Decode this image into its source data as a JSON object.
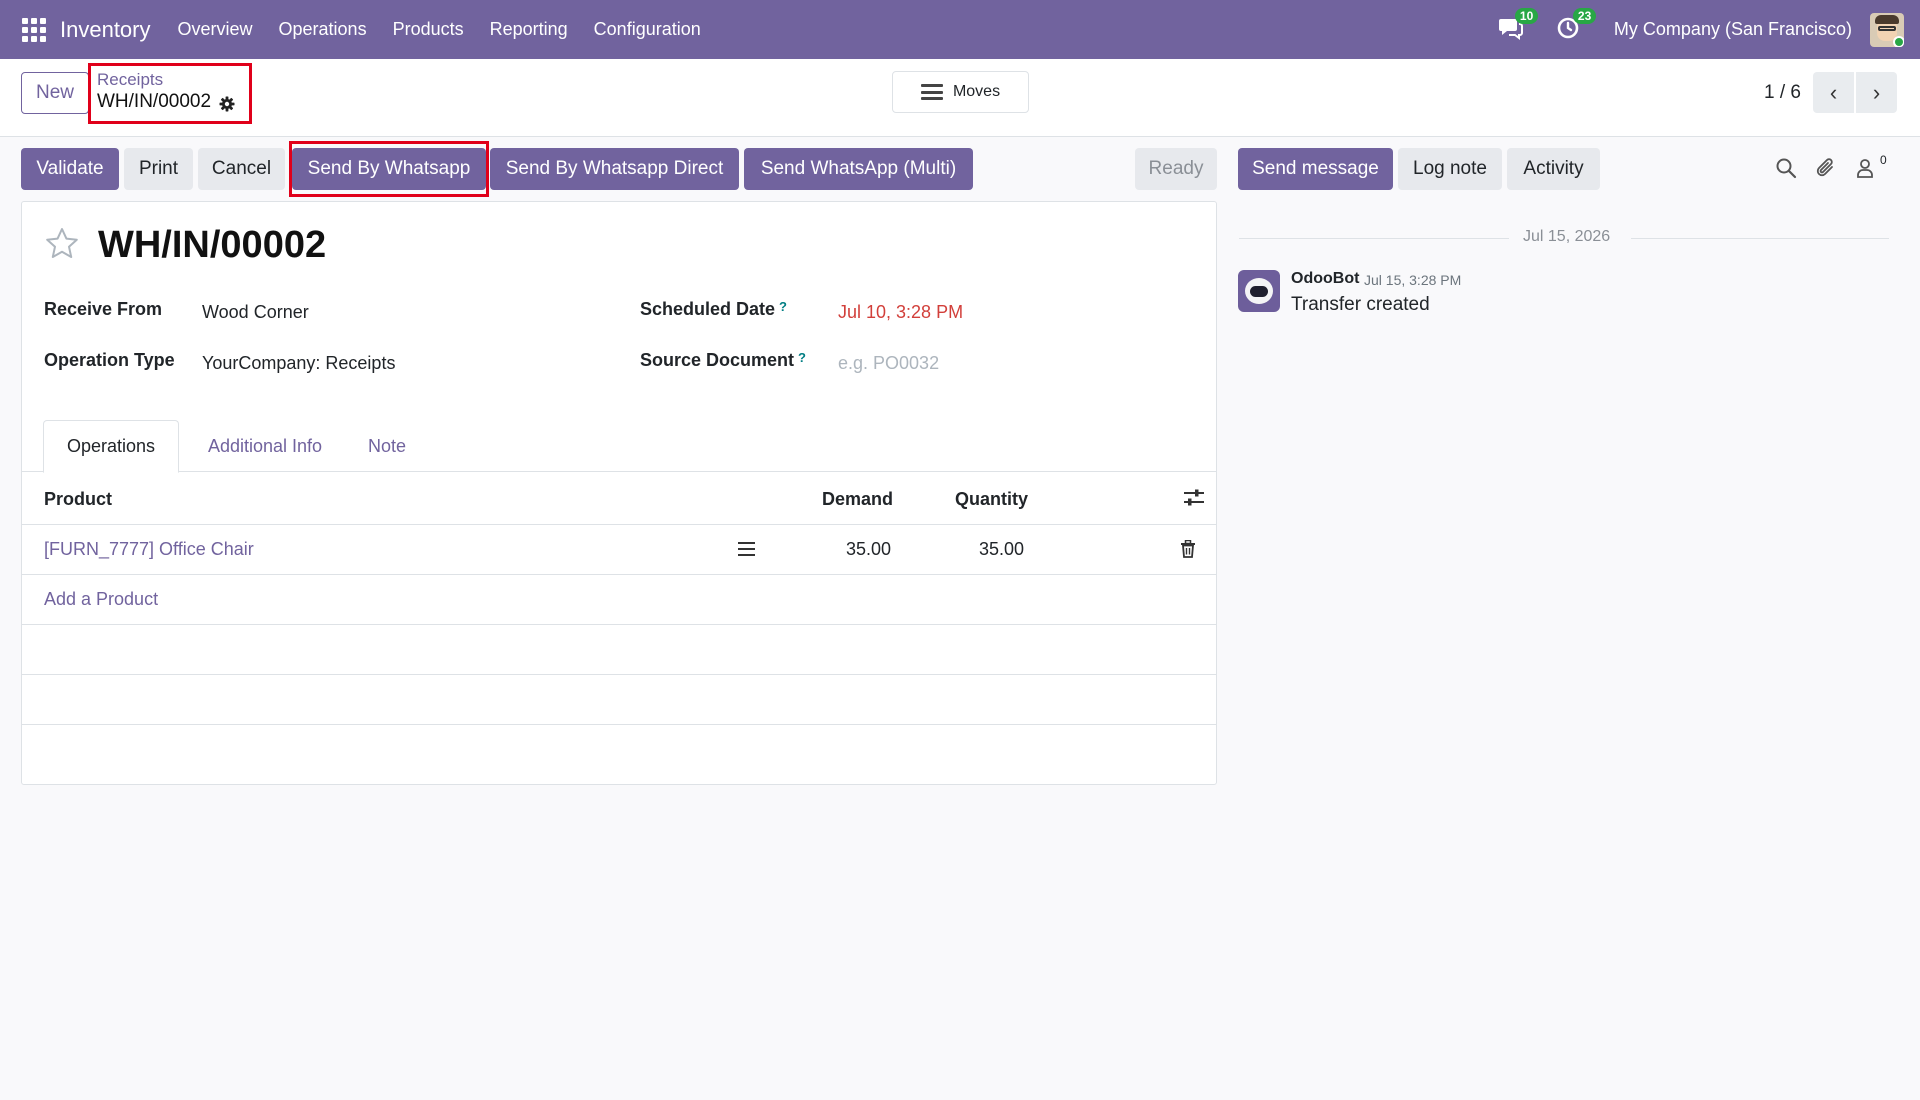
{
  "navbar": {
    "app_name": "Inventory",
    "menu": [
      "Overview",
      "Operations",
      "Products",
      "Reporting",
      "Configuration"
    ],
    "messages_badge": "10",
    "activities_badge": "23",
    "company": "My Company (San Francisco)"
  },
  "control_panel": {
    "new_label": "New",
    "breadcrumb_parent": "Receipts",
    "breadcrumb_current": "WH/IN/00002",
    "moves_label": "Moves",
    "pager_value": "1 / 6"
  },
  "actions": {
    "validate": "Validate",
    "print": "Print",
    "cancel": "Cancel",
    "send_whatsapp": "Send By Whatsapp",
    "send_whatsapp_direct": "Send By Whatsapp Direct",
    "send_whatsapp_multi": "Send WhatsApp (Multi)",
    "status": "Ready"
  },
  "form": {
    "title": "WH/IN/00002",
    "receive_from_label": "Receive From",
    "receive_from_value": "Wood Corner",
    "operation_type_label": "Operation Type",
    "operation_type_value": "YourCompany: Receipts",
    "scheduled_date_label": "Scheduled Date",
    "scheduled_date_value": "Jul 10, 3:28 PM",
    "source_document_label": "Source Document",
    "source_document_placeholder": "e.g. PO0032",
    "help_mark": "?",
    "tabs": [
      "Operations",
      "Additional Info",
      "Note"
    ],
    "table": {
      "headers": {
        "product": "Product",
        "demand": "Demand",
        "quantity": "Quantity"
      },
      "rows": [
        {
          "product": "[FURN_7777] Office Chair",
          "demand": "35.00",
          "quantity": "35.00"
        }
      ],
      "add_product": "Add a Product"
    }
  },
  "chatter": {
    "send_message": "Send message",
    "log_note": "Log note",
    "activity": "Activity",
    "followers_count": "0",
    "date_separator": "Jul 15, 2026",
    "message": {
      "author": "OdooBot",
      "time": "Jul 15, 3:28 PM",
      "body": "Transfer created"
    }
  },
  "colors": {
    "brand": "#71639e",
    "highlight": "#e0001a",
    "badge": "#28a745",
    "overdue_date": "#d23f3a"
  }
}
